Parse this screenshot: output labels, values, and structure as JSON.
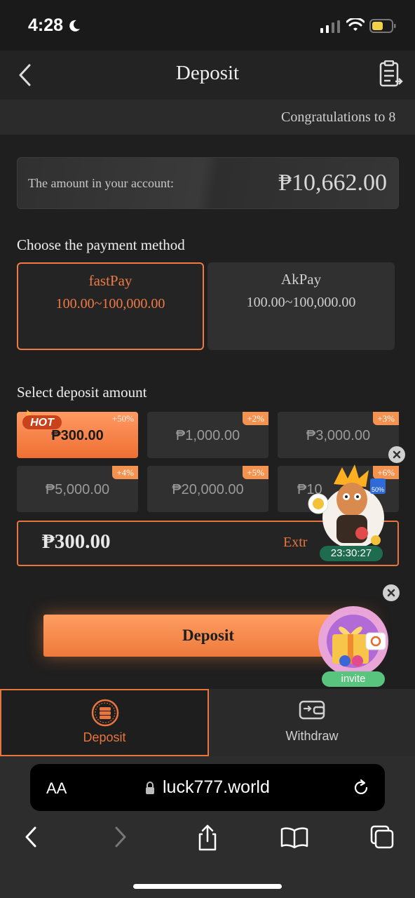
{
  "status_bar": {
    "time": "4:28"
  },
  "header": {
    "title": "Deposit"
  },
  "ticker": {
    "text": "Congratulations to 8"
  },
  "balance": {
    "label": "The amount in your account:",
    "value": "₱10,662.00"
  },
  "payment": {
    "heading": "Choose the payment method",
    "methods": [
      {
        "name": "fastPay",
        "range": "100.00~100,000.00",
        "selected": true
      },
      {
        "name": "AkPay",
        "range": "100.00~100,000.00",
        "selected": false
      }
    ]
  },
  "amounts": {
    "heading": "Select deposit amount",
    "hot_label": "HOT",
    "options": [
      {
        "value": "₱300.00",
        "bonus": "+50%",
        "selected": true
      },
      {
        "value": "₱1,000.00",
        "bonus": "+2%"
      },
      {
        "value": "₱3,000.00",
        "bonus": "+3%"
      },
      {
        "value": "₱5,000.00",
        "bonus": "+4%"
      },
      {
        "value": "₱20,000.00",
        "bonus": "+5%"
      },
      {
        "value": "₱10",
        "bonus": "+6%"
      }
    ]
  },
  "amount_input": {
    "value": "₱300.00",
    "extra_label": "Extr"
  },
  "deposit_button": {
    "label": "Deposit"
  },
  "promo": {
    "timer": "23:30:27",
    "badge": "50%",
    "invite_label": "invite"
  },
  "tabs": [
    {
      "label": "Deposit",
      "active": true
    },
    {
      "label": "Withdraw",
      "active": false
    }
  ],
  "browser": {
    "aa": "AA",
    "url": "luck777.world"
  },
  "colors": {
    "accent": "#f07a45",
    "background": "#1f1f1f"
  }
}
